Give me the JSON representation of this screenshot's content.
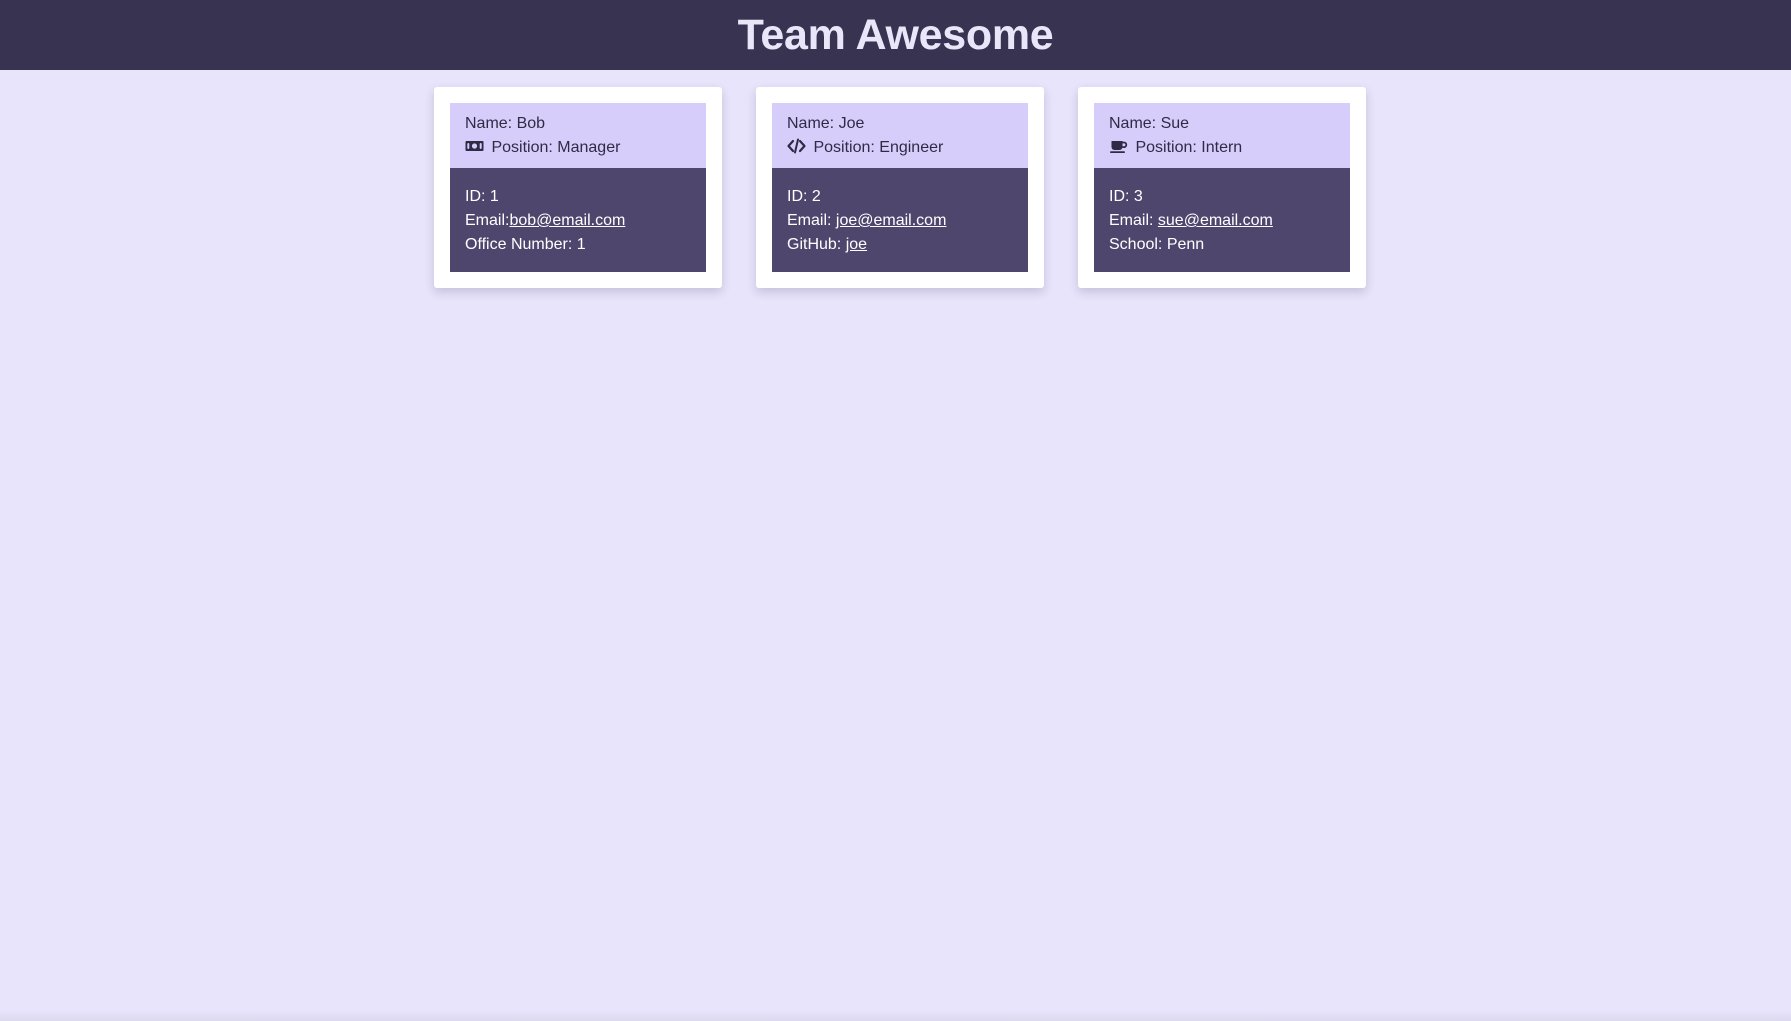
{
  "header": {
    "title": "Team Awesome"
  },
  "colors": {
    "header_bg": "#373350",
    "page_bg": "#e8e4fb",
    "card_top_bg": "#d6cdfb",
    "card_bottom_bg": "#4f466e"
  },
  "cards": [
    {
      "name_label": "Name:",
      "name": "Bob",
      "position_icon": "money-bill-icon",
      "position_label": "Position:",
      "position": "Manager",
      "id_label": "ID:",
      "id": "1",
      "email_label": "Email:",
      "email": "bob@email.com",
      "extra_label": "Office Number:",
      "extra_value": "1"
    },
    {
      "name_label": "Name:",
      "name": "Joe",
      "position_icon": "code-icon",
      "position_label": "Position:",
      "position": "Engineer",
      "id_label": "ID:",
      "id": "2",
      "email_label": "Email:",
      "email": "joe@email.com",
      "extra_label": "GitHub:",
      "extra_value": "joe"
    },
    {
      "name_label": "Name:",
      "name": "Sue",
      "position_icon": "coffee-mug-icon",
      "position_label": "Position:",
      "position": "Intern",
      "id_label": "ID:",
      "id": "3",
      "email_label": "Email:",
      "email": "sue@email.com",
      "extra_label": "School:",
      "extra_value": "Penn"
    }
  ]
}
